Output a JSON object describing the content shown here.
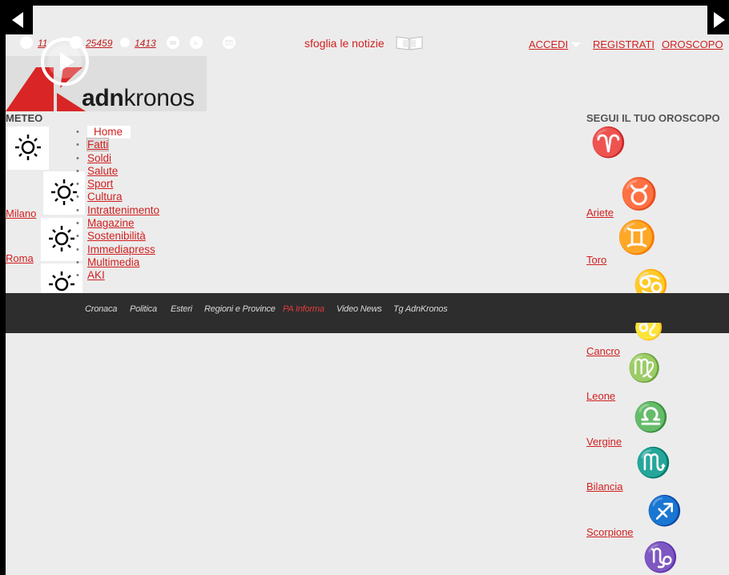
{
  "nav_arrows": {
    "left_icon": "triangle-left-icon",
    "right_icon": "triangle-right-icon"
  },
  "topbar": {
    "social": [
      {
        "icon": "facebook-icon",
        "count": "11"
      },
      {
        "icon": "twitter-icon",
        "count": "25459"
      },
      {
        "icon": "linkedin-icon",
        "count": "1413"
      },
      {
        "icon": "youtube-icon"
      },
      {
        "icon": "rss-icon"
      },
      {
        "icon": "mail-icon"
      }
    ],
    "sfoglia": "sfoglia le notizie",
    "accedi": "ACCEDI",
    "registrati": "REGISTRATI",
    "oroscopo": "OROSCOPO"
  },
  "logo": {
    "brand_bold": "adn",
    "brand_light": "kronos",
    "play_icon": "play-icon"
  },
  "meteo": {
    "title": "METEO",
    "cities": [
      "Milano",
      "Roma"
    ],
    "icon": "sun-icon"
  },
  "menu": {
    "items": [
      "Home",
      "Fatti",
      "Soldi",
      "Salute",
      "Sport",
      "Cultura",
      "Intrattenimento",
      "Magazine",
      "Sostenibilità",
      "Immediapress",
      "Multimedia",
      "AKI"
    ]
  },
  "categories": {
    "items": [
      "Cronaca",
      "Politica",
      "Esteri",
      "Regioni e Province",
      "PA Informa",
      "Video News",
      "Tg AdnKronos"
    ],
    "active": "PA Informa",
    "accent": "#e33b3b"
  },
  "oroscopo": {
    "title": "SEGUI IL TUO OROSCOPO",
    "signs": [
      "Ariete",
      "Toro",
      "Cancro",
      "Leone",
      "Vergine",
      "Bilancia",
      "Scorpione"
    ],
    "glyphs": [
      "♈",
      "♉",
      "♊",
      "♋",
      "♌",
      "♍",
      "♎",
      "♏",
      "♐",
      "♑"
    ]
  },
  "colors": {
    "link": "#d21f1f",
    "bar": "#2d2d2d",
    "page_bg": "#ececec"
  }
}
